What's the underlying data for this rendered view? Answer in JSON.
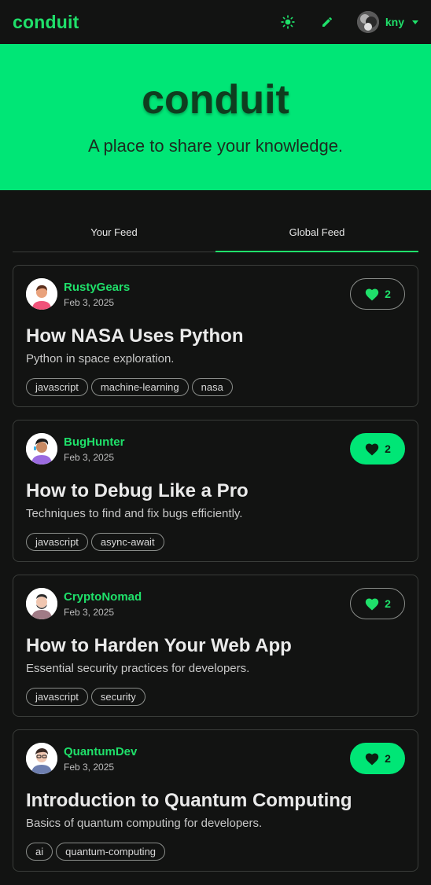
{
  "navbar": {
    "brand": "conduit",
    "username": "kny",
    "icons": [
      "sun-icon",
      "pencil-icon",
      "chevron-down-icon"
    ]
  },
  "hero": {
    "title": "conduit",
    "subtitle": "A place to share your knowledge."
  },
  "tabs": [
    {
      "label": "Your Feed",
      "active": false
    },
    {
      "label": "Global Feed",
      "active": true
    }
  ],
  "colors": {
    "accent": "#00e676",
    "background": "#121312",
    "border": "#3a3d3a"
  },
  "articles": [
    {
      "author": "RustyGears",
      "date": "Feb 3, 2025",
      "favorites": "2",
      "favorited": false,
      "title": "How NASA Uses Python",
      "description": "Python in space exploration.",
      "tags": [
        "javascript",
        "machine-learning",
        "nasa"
      ]
    },
    {
      "author": "BugHunter",
      "date": "Feb 3, 2025",
      "favorites": "2",
      "favorited": true,
      "title": "How to Debug Like a Pro",
      "description": "Techniques to find and fix bugs efficiently.",
      "tags": [
        "javascript",
        "async-await"
      ]
    },
    {
      "author": "CryptoNomad",
      "date": "Feb 3, 2025",
      "favorites": "2",
      "favorited": false,
      "title": "How to Harden Your Web App",
      "description": "Essential security practices for developers.",
      "tags": [
        "javascript",
        "security"
      ]
    },
    {
      "author": "QuantumDev",
      "date": "Feb 3, 2025",
      "favorites": "2",
      "favorited": true,
      "title": "Introduction to Quantum Computing",
      "description": "Basics of quantum computing for developers.",
      "tags": [
        "ai",
        "quantum-computing"
      ]
    }
  ]
}
